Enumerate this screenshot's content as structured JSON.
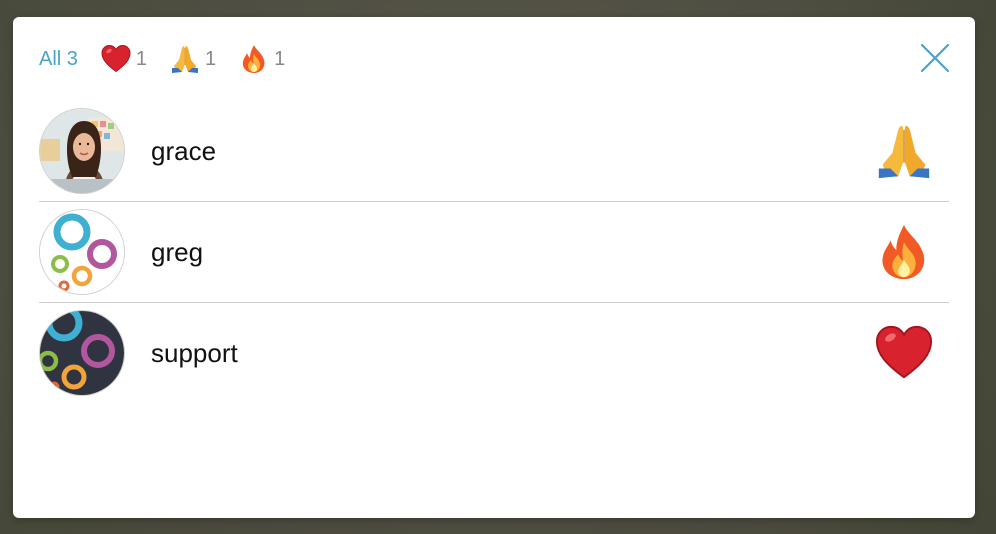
{
  "colors": {
    "accent": "#4aa3c8",
    "count_text": "#888888",
    "divider": "#cfcfcf"
  },
  "tabs": [
    {
      "label": "All 3",
      "emoji": null,
      "count": null
    },
    {
      "label": null,
      "emoji": "heart-icon",
      "count": "1"
    },
    {
      "label": null,
      "emoji": "folded-hands-icon",
      "count": "1"
    },
    {
      "label": null,
      "emoji": "fire-icon",
      "count": "1"
    }
  ],
  "close": {
    "icon": "close-icon"
  },
  "reactions": [
    {
      "username": "grace",
      "avatar": "photo-avatar",
      "reaction": "folded-hands-icon"
    },
    {
      "username": "greg",
      "avatar": "circles-avatar-light",
      "reaction": "fire-icon"
    },
    {
      "username": "support",
      "avatar": "circles-avatar-dark",
      "reaction": "heart-icon"
    }
  ]
}
